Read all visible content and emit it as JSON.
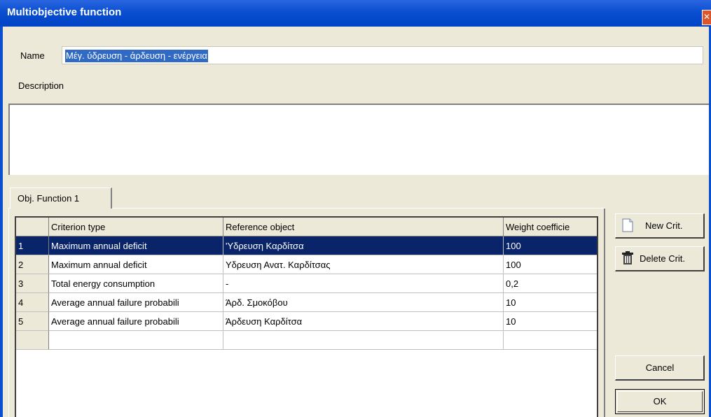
{
  "window": {
    "title": "Multiobjective function",
    "close_glyph": "✕"
  },
  "form": {
    "name_label": "Name",
    "name_value": "Μέγ. ύδρευση - άρδευση - ενέργεια",
    "description_label": "Description",
    "description_value": ""
  },
  "tabs": [
    {
      "label": "Obj. Function 1",
      "active": true
    }
  ],
  "grid": {
    "columns": [
      "",
      "Criterion type",
      "Reference object",
      "Weight coefficie"
    ],
    "rows": [
      {
        "index": "1",
        "criterion": "Maximum annual deficit",
        "reference": "'Υδρευση Καρδίτσα",
        "weight": "100",
        "selected": true
      },
      {
        "index": "2",
        "criterion": "Maximum annual deficit",
        "reference": "Υδρευση Ανατ. Καρδίτσας",
        "weight": "100",
        "selected": false
      },
      {
        "index": "3",
        "criterion": "Total energy consumption",
        "reference": "-",
        "weight": "0,2",
        "selected": false
      },
      {
        "index": "4",
        "criterion": "Average annual failure probabili",
        "reference": "Άρδ. Σμοκόβου",
        "weight": "10",
        "selected": false
      },
      {
        "index": "5",
        "criterion": "Average annual failure probabili",
        "reference": "Άρδευση Καρδίτσα",
        "weight": "10",
        "selected": false
      }
    ]
  },
  "buttons": {
    "new_crit": "New Crit.",
    "delete_crit": "Delete Crit.",
    "cancel": "Cancel",
    "ok": "OK"
  },
  "icons": {
    "new_crit": "document-icon",
    "delete_crit": "trash-icon"
  },
  "colors": {
    "title_bar": "#0a4fd0",
    "selection": "#0a246a",
    "text_selection": "#316ac5",
    "face": "#ece9d8"
  }
}
